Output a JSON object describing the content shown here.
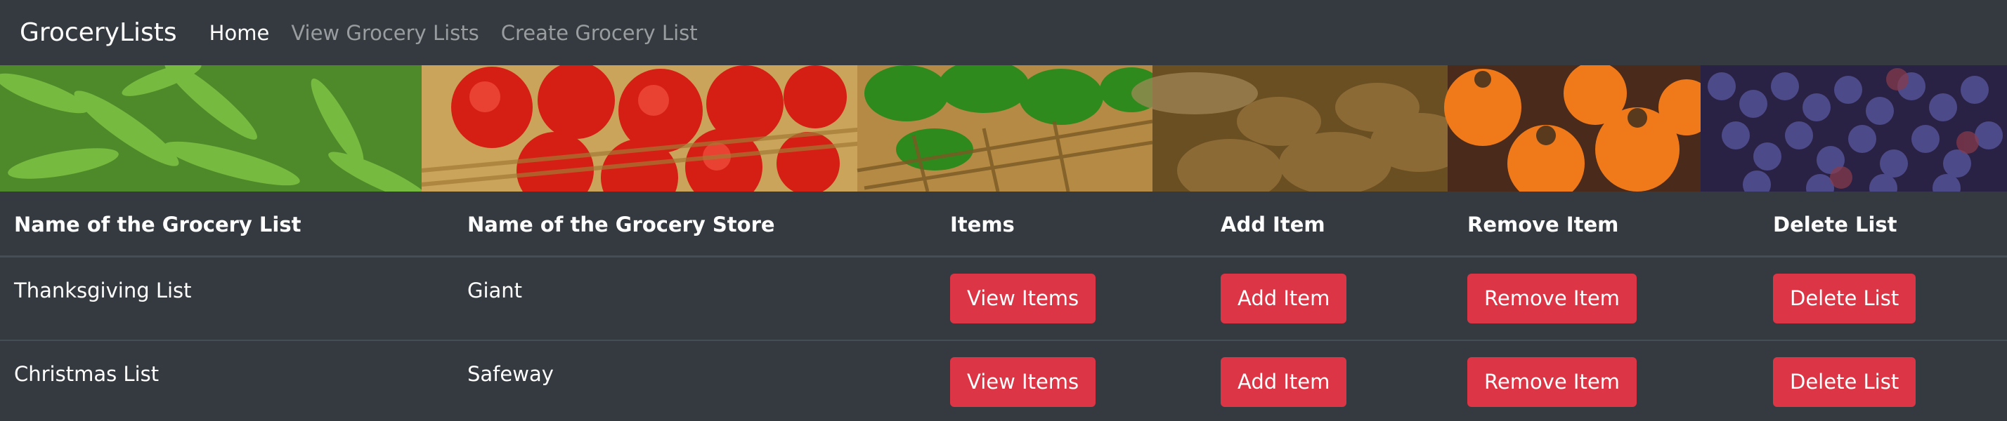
{
  "nav": {
    "brand": "GroceryLists",
    "links": [
      "Home",
      "View Grocery Lists",
      "Create Grocery List"
    ]
  },
  "banner": {
    "description_icon": "produce-banner"
  },
  "table": {
    "headers": [
      "Name of the Grocery List",
      "Name of the Grocery Store",
      "Items",
      "Add Item",
      "Remove Item",
      "Delete List"
    ],
    "rows": [
      {
        "list_name": "Thanksgiving List",
        "store_name": "Giant",
        "view_label": "View Items",
        "add_label": "Add Item",
        "remove_label": "Remove Item",
        "delete_label": "Delete List"
      },
      {
        "list_name": "Christmas List",
        "store_name": "Safeway",
        "view_label": "View Items",
        "add_label": "Add Item",
        "remove_label": "Remove Item",
        "delete_label": "Delete List"
      }
    ]
  },
  "colors": {
    "background": "#343a40",
    "danger": "#dc3545",
    "muted_link": "#9a9da0"
  }
}
